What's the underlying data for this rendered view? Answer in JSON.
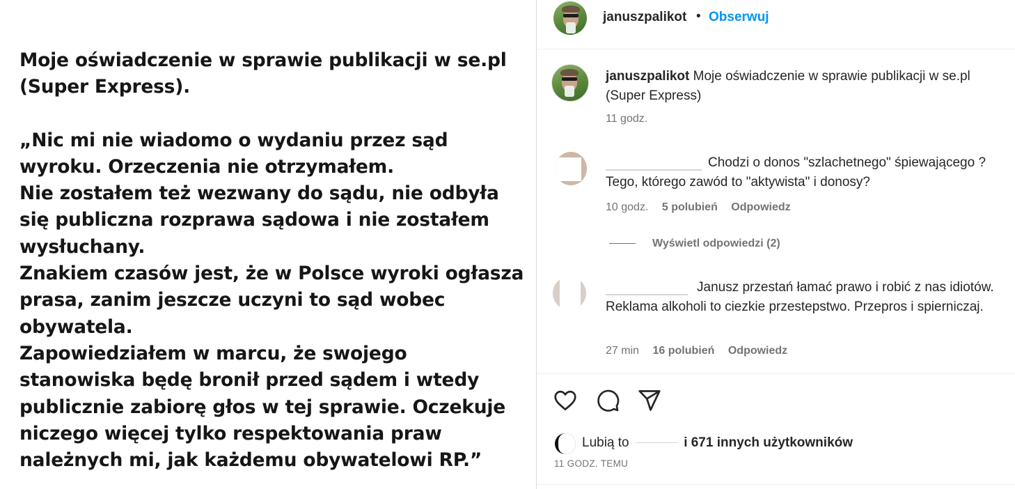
{
  "post_image": {
    "lines": [
      "Moje oświadczenie w sprawie publikacji w se.pl",
      "(Super Express).",
      "",
      "„Nic mi nie wiadomo o wydaniu przez sąd",
      "wyroku. Orzeczenia nie otrzymałem.",
      "Nie zostałem też wezwany do sądu, nie odbyła",
      "się publiczna rozprawa sądowa i nie zostałem",
      "wysłuchany.",
      "Znakiem czasów jest, że w Polsce wyroki ogłasza",
      "prasa, zanim jeszcze uczyni to sąd wobec",
      "obywatela.",
      "Zapowiedziałem w marcu, że swojego",
      "stanowiska będę bronił przed sądem i wtedy",
      "publicznie zabiorę głos w tej sprawie. Oczekuje",
      "niczego więcej tylko respektowania praw",
      "należnych mi, jak każdemu obywatelowi RP.”"
    ]
  },
  "header": {
    "username": "januszpalikot",
    "separator": "•",
    "follow_label": "Obserwuj"
  },
  "caption": {
    "username": "januszpalikot",
    "text": "Moje oświadczenie w sprawie publikacji w se.pl (Super Express)",
    "time": "11 godz."
  },
  "comments": [
    {
      "text": "Chodzi o donos \"szlachetnego\" śpiewającego ? Tego, którego zawód to \"aktywista\" i donosy?",
      "time": "10 godz.",
      "likes": "5 polubień",
      "reply_label": "Odpowiedz",
      "view_replies": "Wyświetl odpowiedzi (2)"
    },
    {
      "text": "Janusz przestań łamać prawo i robić z nas idiotów. Reklama alkoholi to ciezkie przestepstwo. Przepros i spierniczaj.",
      "time": "27 min",
      "likes": "16 polubień",
      "reply_label": "Odpowiedz"
    }
  ],
  "actions": {
    "like_icon": "heart-icon",
    "comment_icon": "comment-icon",
    "share_icon": "send-icon"
  },
  "likes_summary": {
    "prefix": "Lubią to",
    "suffix": "i 671 innych użytkowników"
  },
  "post_time": "11 GODZ. TEMU",
  "colors": {
    "link_blue": "#0095f6",
    "secondary_text": "#737373",
    "primary_text": "#262626"
  }
}
